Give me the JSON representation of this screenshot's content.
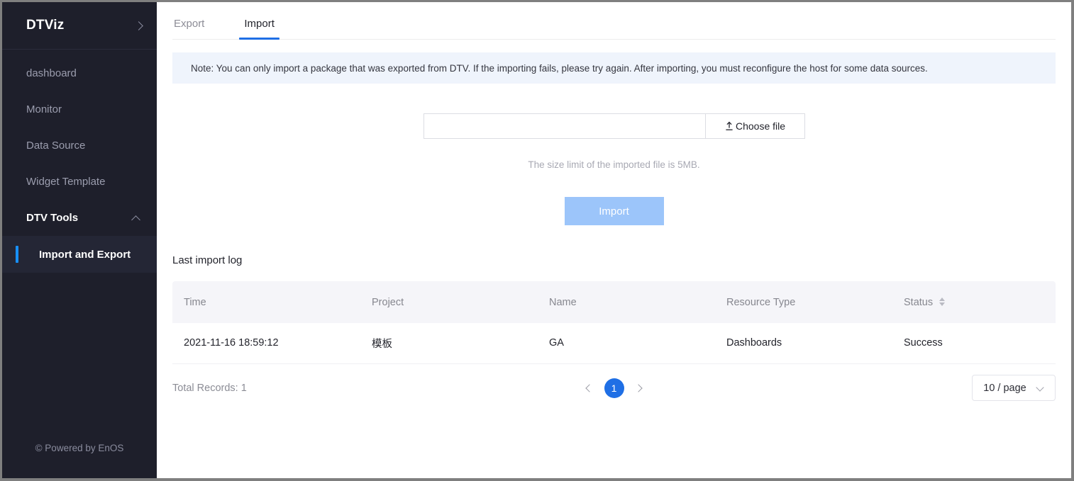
{
  "sidebar": {
    "brand": "DTViz",
    "expand_icon": "chevron-right-icon",
    "items": [
      {
        "label": "dashboard",
        "type": "link"
      },
      {
        "label": "Monitor",
        "type": "link"
      },
      {
        "label": "Data Source",
        "type": "link"
      },
      {
        "label": "Widget Template",
        "type": "link"
      },
      {
        "label": "DTV Tools",
        "type": "group",
        "collapse_icon": "chevron-up-icon"
      },
      {
        "label": "Import and Export",
        "type": "child",
        "active": true
      }
    ],
    "footer": "© Powered by EnOS",
    "bg_color": "#1e1f2b",
    "active_indicator_color": "#1890ff"
  },
  "main": {
    "tabs": [
      {
        "label": "Export",
        "active": false
      },
      {
        "label": "Import",
        "active": true
      }
    ],
    "note": "Note: You can only import a package that was exported from DTV. If the importing fails, please try again. After importing, you must reconfigure the host for some data sources.",
    "upload": {
      "file_value": "",
      "file_placeholder": "",
      "choose_file_label": "Choose file",
      "choose_file_icon": "upload-icon",
      "size_hint": "The size limit of the imported file is 5MB.",
      "import_button_label": "Import"
    },
    "log": {
      "title": "Last import log",
      "columns": [
        {
          "label": "Time",
          "sortable": false
        },
        {
          "label": "Project",
          "sortable": false
        },
        {
          "label": "Name",
          "sortable": false
        },
        {
          "label": "Resource Type",
          "sortable": false
        },
        {
          "label": "Status",
          "sortable": true,
          "sort_icon": "sort-updown-icon"
        }
      ],
      "rows": [
        {
          "time": "2021-11-16 18:59:12",
          "project": "模板",
          "name": "GA",
          "resource_type": "Dashboards",
          "status": "Success"
        }
      ],
      "total_records": "Total Records: 1",
      "pagination": {
        "prev_icon": "chevron-left-icon",
        "next_icon": "chevron-right-icon",
        "current_page": "1"
      },
      "page_size": "10 / page",
      "page_size_icon": "chevron-down-icon"
    }
  },
  "colors": {
    "accent_blue": "#1f6fe5",
    "note_bg": "#eff4fc",
    "table_header_bg": "#f5f5f9",
    "import_button_bg": "#9cc5fa"
  }
}
